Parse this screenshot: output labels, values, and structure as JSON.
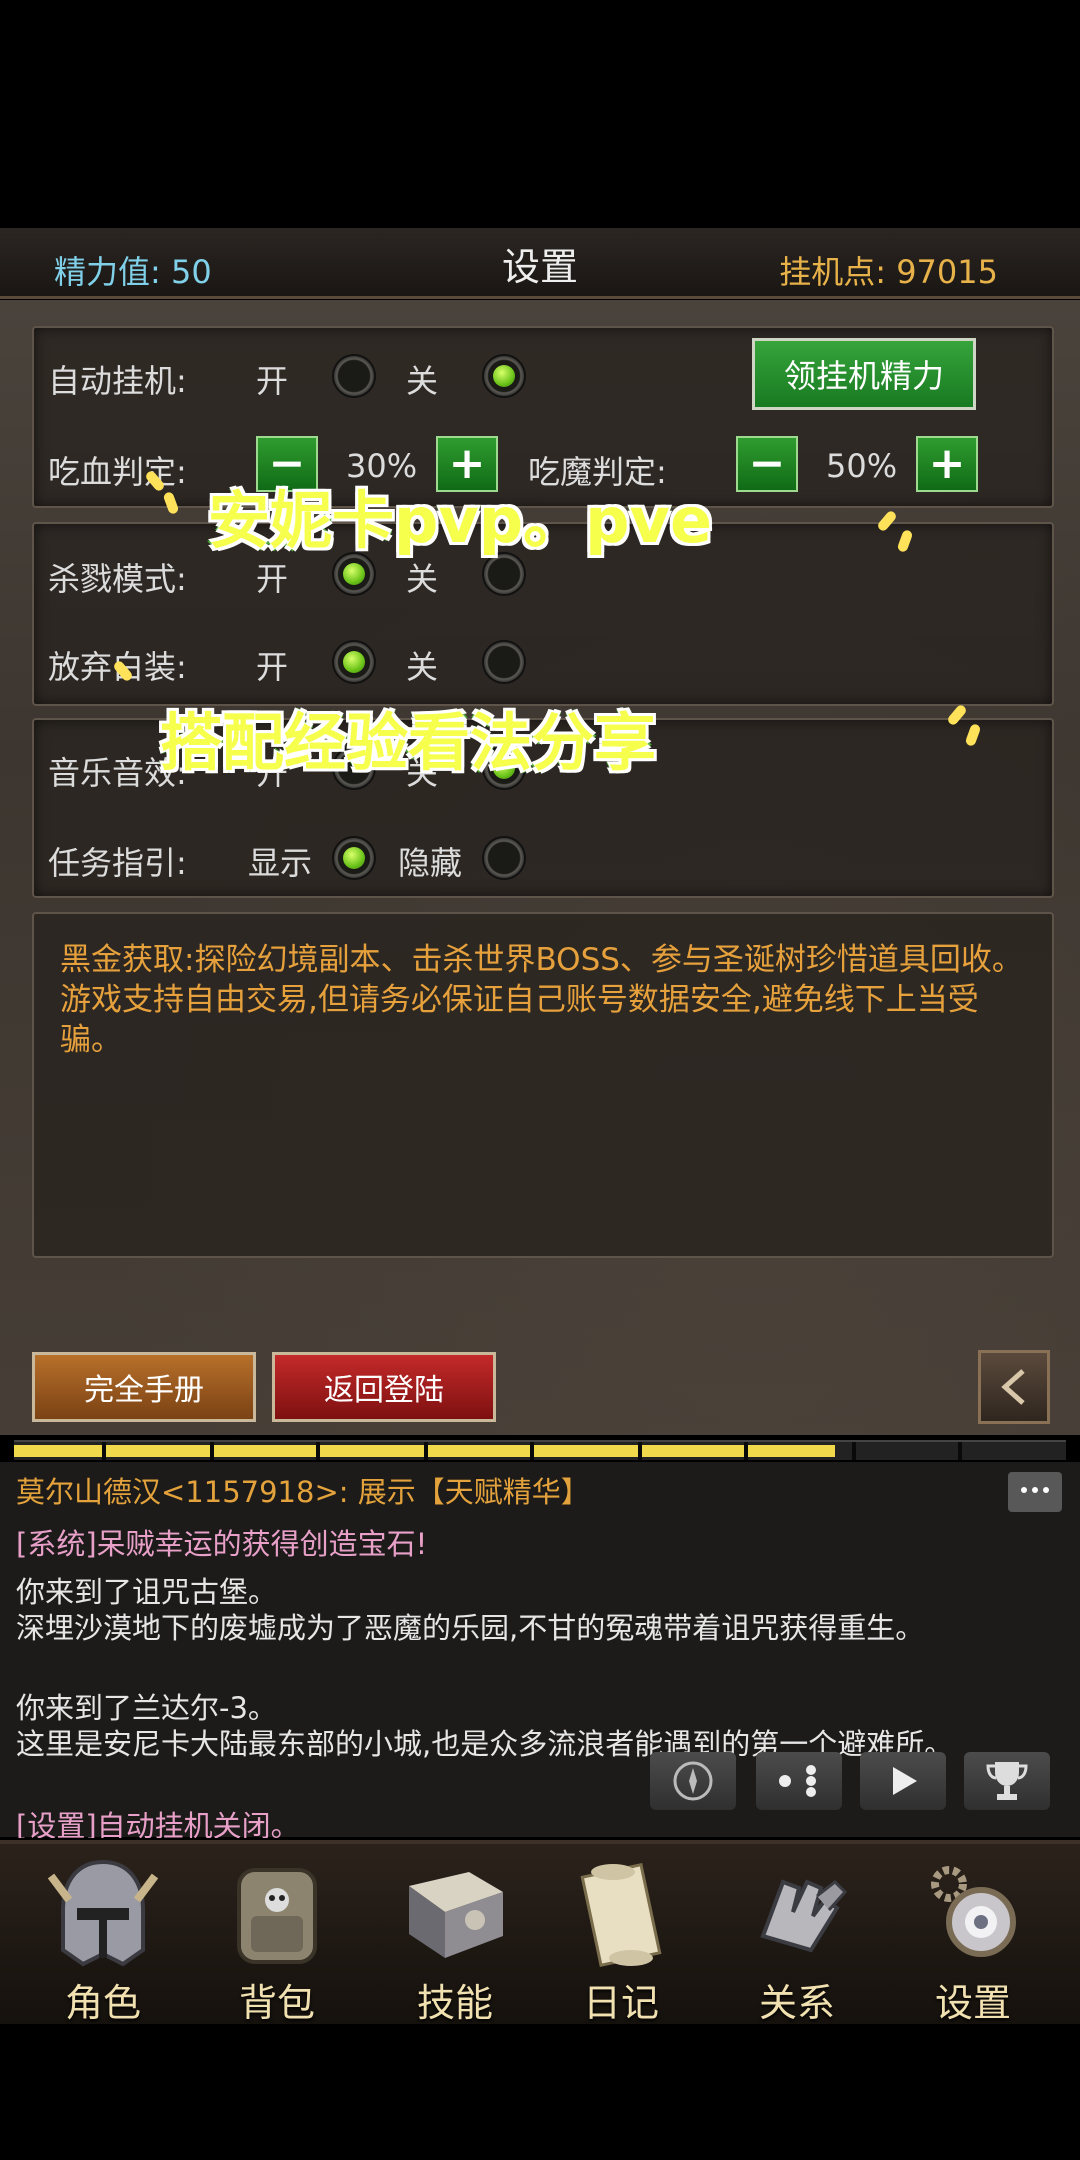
{
  "header": {
    "energy": "精力值: 50",
    "title": "设置",
    "idle_points": "挂机点: 97015"
  },
  "settings": {
    "auto_idle": {
      "label": "自动挂机:",
      "on": "开",
      "off": "关",
      "selected": "off"
    },
    "claim_button": "领挂机精力",
    "hp_threshold": {
      "label": "吃血判定:",
      "value": "30%"
    },
    "mp_threshold": {
      "label": "吃魔判定:",
      "value": "50%"
    },
    "kill_mode": {
      "label": "杀戮模式:",
      "on": "开",
      "off": "关",
      "selected": "on"
    },
    "discard_white": {
      "label": "放弃白装:",
      "on": "开",
      "off": "关",
      "selected": "on"
    },
    "music": {
      "label": "音乐音效:",
      "on": "开",
      "off": "关",
      "selected": "off"
    },
    "quest_guide": {
      "label": "任务指引:",
      "on": "显示",
      "off": "隐藏",
      "selected": "on"
    }
  },
  "notice": {
    "line1": "黑金获取:探险幻境副本、击杀世界BOSS、参与圣诞树珍惜道具回收。",
    "line2": "游戏支持自由交易,但请务必保证自己账号数据安全,避免线下上当受骗。"
  },
  "buttons": {
    "manual": "完全手册",
    "relogin": "返回登陆"
  },
  "xp_progress": 0.78,
  "chat": {
    "lines": [
      {
        "text": "莫尔山德汉<1157918>: 展示【天赋精华】",
        "color": "#e3a23b"
      },
      {
        "text": "[系统]呆贼幸运的获得创造宝石!",
        "color": "#e8a0c8"
      },
      {
        "text": "你来到了诅咒古堡。",
        "color": "#e6e6e6"
      },
      {
        "text": "深埋沙漠地下的废墟成为了恶魔的乐园,不甘的冤魂带着诅咒获得重生。",
        "color": "#e6e6e6"
      },
      {
        "text": "你来到了兰达尔-3。",
        "color": "#e6e6e6"
      },
      {
        "text": "这里是安尼卡大陆最东部的小城,也是众多流浪者能遇到的第一个避难所。",
        "color": "#e6e6e6"
      },
      {
        "text": "[设置]自动挂机关闭。",
        "color": "#e8a0c8"
      }
    ]
  },
  "nav": {
    "items": [
      {
        "label": "角色",
        "icon": "helmet-icon"
      },
      {
        "label": "背包",
        "icon": "backpack-icon"
      },
      {
        "label": "技能",
        "icon": "skill-book-icon"
      },
      {
        "label": "日记",
        "icon": "scroll-icon"
      },
      {
        "label": "关系",
        "icon": "gauntlet-icon"
      },
      {
        "label": "设置",
        "icon": "settings-gear-icon"
      }
    ]
  },
  "overlay": {
    "line1": "安妮卡pvp。pve",
    "line2": "搭配经验看法分享"
  },
  "colors": {
    "accent_green": "#2f9c2f",
    "energy_text": "#7fd0e8",
    "points_text": "#e8b24a",
    "notice_text": "#e6a13c"
  }
}
